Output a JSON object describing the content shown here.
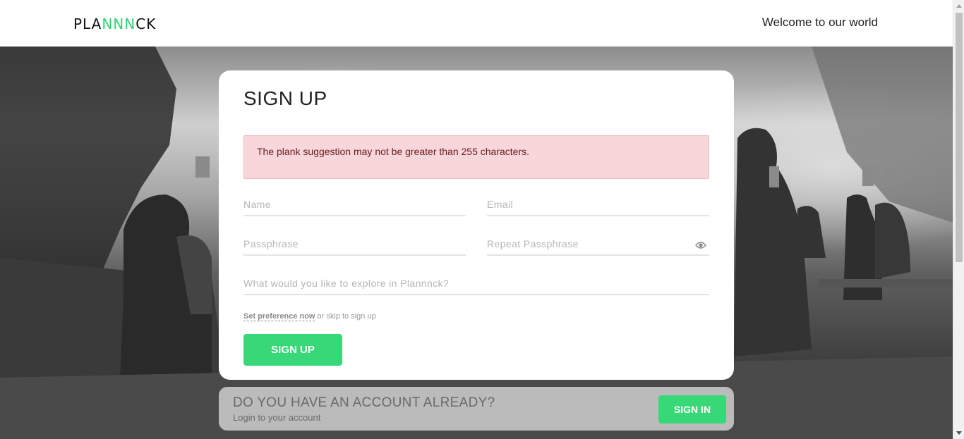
{
  "header": {
    "logo": {
      "part_a": "PLA",
      "part_b": "NNN",
      "part_c": "CK"
    },
    "welcome": "Welcome to our world"
  },
  "signup": {
    "title": "SIGN UP",
    "alert": "The plank suggestion may not be greater than 255 characters.",
    "fields": {
      "name_placeholder": "Name",
      "email_placeholder": "Email",
      "passphrase_placeholder": "Passphrase",
      "repeat_placeholder": "Repeat Passphrase",
      "explore_placeholder": "What would you like to explore in Plannnck?"
    },
    "preference_link": "Set preference now",
    "preference_suffix": " or skip to sign up",
    "button": "SIGN UP"
  },
  "account": {
    "title": "DO YOU HAVE AN ACCOUNT ALREADY?",
    "subtitle": "Login to your account",
    "button": "SIGN IN"
  },
  "colors": {
    "accent": "#38d878",
    "alert_bg": "#f8d7da",
    "alert_text": "#6b1a1f"
  },
  "icons": {
    "password_toggle": "eye-icon"
  }
}
